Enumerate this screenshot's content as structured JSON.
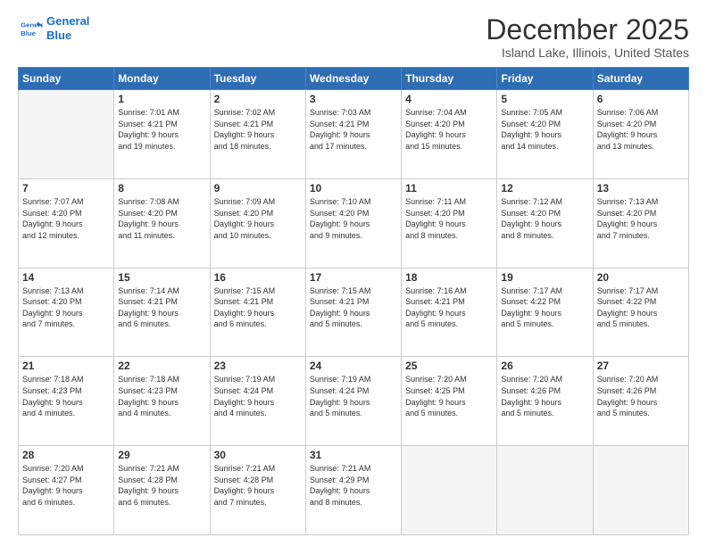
{
  "logo": {
    "line1": "General",
    "line2": "Blue"
  },
  "header": {
    "title": "December 2025",
    "subtitle": "Island Lake, Illinois, United States"
  },
  "days_of_week": [
    "Sunday",
    "Monday",
    "Tuesday",
    "Wednesday",
    "Thursday",
    "Friday",
    "Saturday"
  ],
  "weeks": [
    [
      {
        "day": "",
        "info": ""
      },
      {
        "day": "1",
        "info": "Sunrise: 7:01 AM\nSunset: 4:21 PM\nDaylight: 9 hours\nand 19 minutes."
      },
      {
        "day": "2",
        "info": "Sunrise: 7:02 AM\nSunset: 4:21 PM\nDaylight: 9 hours\nand 18 minutes."
      },
      {
        "day": "3",
        "info": "Sunrise: 7:03 AM\nSunset: 4:21 PM\nDaylight: 9 hours\nand 17 minutes."
      },
      {
        "day": "4",
        "info": "Sunrise: 7:04 AM\nSunset: 4:20 PM\nDaylight: 9 hours\nand 15 minutes."
      },
      {
        "day": "5",
        "info": "Sunrise: 7:05 AM\nSunset: 4:20 PM\nDaylight: 9 hours\nand 14 minutes."
      },
      {
        "day": "6",
        "info": "Sunrise: 7:06 AM\nSunset: 4:20 PM\nDaylight: 9 hours\nand 13 minutes."
      }
    ],
    [
      {
        "day": "7",
        "info": "Sunrise: 7:07 AM\nSunset: 4:20 PM\nDaylight: 9 hours\nand 12 minutes."
      },
      {
        "day": "8",
        "info": "Sunrise: 7:08 AM\nSunset: 4:20 PM\nDaylight: 9 hours\nand 11 minutes."
      },
      {
        "day": "9",
        "info": "Sunrise: 7:09 AM\nSunset: 4:20 PM\nDaylight: 9 hours\nand 10 minutes."
      },
      {
        "day": "10",
        "info": "Sunrise: 7:10 AM\nSunset: 4:20 PM\nDaylight: 9 hours\nand 9 minutes."
      },
      {
        "day": "11",
        "info": "Sunrise: 7:11 AM\nSunset: 4:20 PM\nDaylight: 9 hours\nand 8 minutes."
      },
      {
        "day": "12",
        "info": "Sunrise: 7:12 AM\nSunset: 4:20 PM\nDaylight: 9 hours\nand 8 minutes."
      },
      {
        "day": "13",
        "info": "Sunrise: 7:13 AM\nSunset: 4:20 PM\nDaylight: 9 hours\nand 7 minutes."
      }
    ],
    [
      {
        "day": "14",
        "info": "Sunrise: 7:13 AM\nSunset: 4:20 PM\nDaylight: 9 hours\nand 7 minutes."
      },
      {
        "day": "15",
        "info": "Sunrise: 7:14 AM\nSunset: 4:21 PM\nDaylight: 9 hours\nand 6 minutes."
      },
      {
        "day": "16",
        "info": "Sunrise: 7:15 AM\nSunset: 4:21 PM\nDaylight: 9 hours\nand 6 minutes."
      },
      {
        "day": "17",
        "info": "Sunrise: 7:15 AM\nSunset: 4:21 PM\nDaylight: 9 hours\nand 5 minutes."
      },
      {
        "day": "18",
        "info": "Sunrise: 7:16 AM\nSunset: 4:21 PM\nDaylight: 9 hours\nand 5 minutes."
      },
      {
        "day": "19",
        "info": "Sunrise: 7:17 AM\nSunset: 4:22 PM\nDaylight: 9 hours\nand 5 minutes."
      },
      {
        "day": "20",
        "info": "Sunrise: 7:17 AM\nSunset: 4:22 PM\nDaylight: 9 hours\nand 5 minutes."
      }
    ],
    [
      {
        "day": "21",
        "info": "Sunrise: 7:18 AM\nSunset: 4:23 PM\nDaylight: 9 hours\nand 4 minutes."
      },
      {
        "day": "22",
        "info": "Sunrise: 7:18 AM\nSunset: 4:23 PM\nDaylight: 9 hours\nand 4 minutes."
      },
      {
        "day": "23",
        "info": "Sunrise: 7:19 AM\nSunset: 4:24 PM\nDaylight: 9 hours\nand 4 minutes."
      },
      {
        "day": "24",
        "info": "Sunrise: 7:19 AM\nSunset: 4:24 PM\nDaylight: 9 hours\nand 5 minutes."
      },
      {
        "day": "25",
        "info": "Sunrise: 7:20 AM\nSunset: 4:25 PM\nDaylight: 9 hours\nand 5 minutes."
      },
      {
        "day": "26",
        "info": "Sunrise: 7:20 AM\nSunset: 4:26 PM\nDaylight: 9 hours\nand 5 minutes."
      },
      {
        "day": "27",
        "info": "Sunrise: 7:20 AM\nSunset: 4:26 PM\nDaylight: 9 hours\nand 5 minutes."
      }
    ],
    [
      {
        "day": "28",
        "info": "Sunrise: 7:20 AM\nSunset: 4:27 PM\nDaylight: 9 hours\nand 6 minutes."
      },
      {
        "day": "29",
        "info": "Sunrise: 7:21 AM\nSunset: 4:28 PM\nDaylight: 9 hours\nand 6 minutes."
      },
      {
        "day": "30",
        "info": "Sunrise: 7:21 AM\nSunset: 4:28 PM\nDaylight: 9 hours\nand 7 minutes."
      },
      {
        "day": "31",
        "info": "Sunrise: 7:21 AM\nSunset: 4:29 PM\nDaylight: 9 hours\nand 8 minutes."
      },
      {
        "day": "",
        "info": ""
      },
      {
        "day": "",
        "info": ""
      },
      {
        "day": "",
        "info": ""
      }
    ]
  ]
}
